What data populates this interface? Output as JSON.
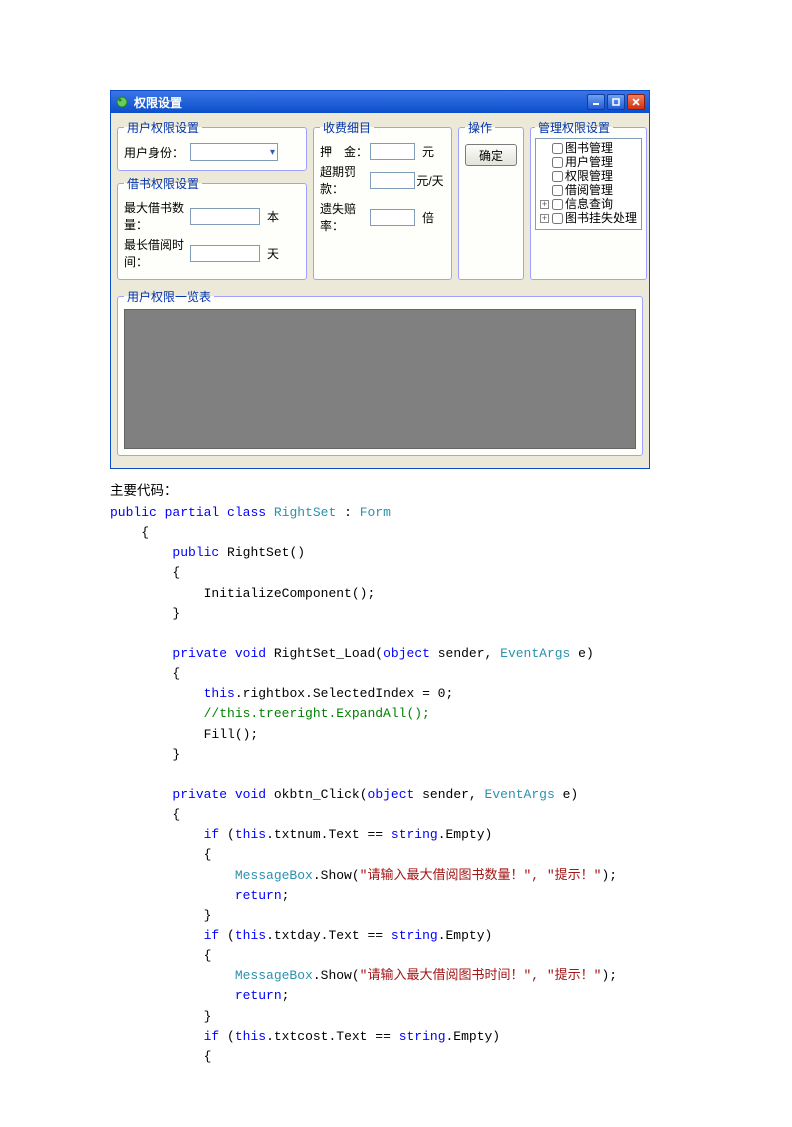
{
  "window": {
    "title": "权限设置",
    "group_user_right": "用户权限设置",
    "label_identity": "用户身份：",
    "group_borrow": "借书权限设置",
    "label_max_num": "最大借书数量：",
    "unit_ben": "本",
    "label_max_day": "最长借阅时间：",
    "unit_tian": "天",
    "group_fee": "收费细目",
    "label_deposit": "押　金：",
    "unit_yuan": "元",
    "label_fine": "超期罚款：",
    "unit_yuan_day": "元/天",
    "label_lost": "遗失赔率：",
    "unit_bei": "倍",
    "group_op": "操作",
    "ok_label": "确定",
    "group_admin": "管理权限设置",
    "tree": {
      "n0": "图书管理",
      "n1": "用户管理",
      "n2": "权限管理",
      "n3": "借阅管理",
      "n4": "信息查询",
      "n5": "图书挂失处理"
    },
    "group_list": "用户权限一览表"
  },
  "code": {
    "caption": "主要代码：",
    "tokens": {
      "public": "public",
      "partial": "partial",
      "class": "class",
      "Form": "Form",
      "RightSet": "RightSet",
      "private": "private",
      "void": "void",
      "object": "object",
      "this": "this",
      "EventArgs": "EventArgs",
      "string": "string",
      "if": "if",
      "return": "return",
      "MessageBox": "MessageBox",
      "load": "RightSet_Load",
      "okbtn": "okbtn_Click",
      "init": "InitializeComponent();",
      "sel": ".rightbox.SelectedIndex = 0;",
      "expand": "//this.treeright.ExpandAll();",
      "fill": "Fill();",
      "txtnum": ".txtnum.Text == ",
      "txtday": ".txtday.Text == ",
      "txtcost": ".txtcost.Text == ",
      "empty": ".Empty)",
      "show": ".Show(",
      "s_num": "\"请输入最大借阅图书数量！\"",
      "s_day": "\"请输入最大借阅图书时间！\"",
      "s_tip": ", \"提示！\"",
      "rpar": ");"
    }
  }
}
